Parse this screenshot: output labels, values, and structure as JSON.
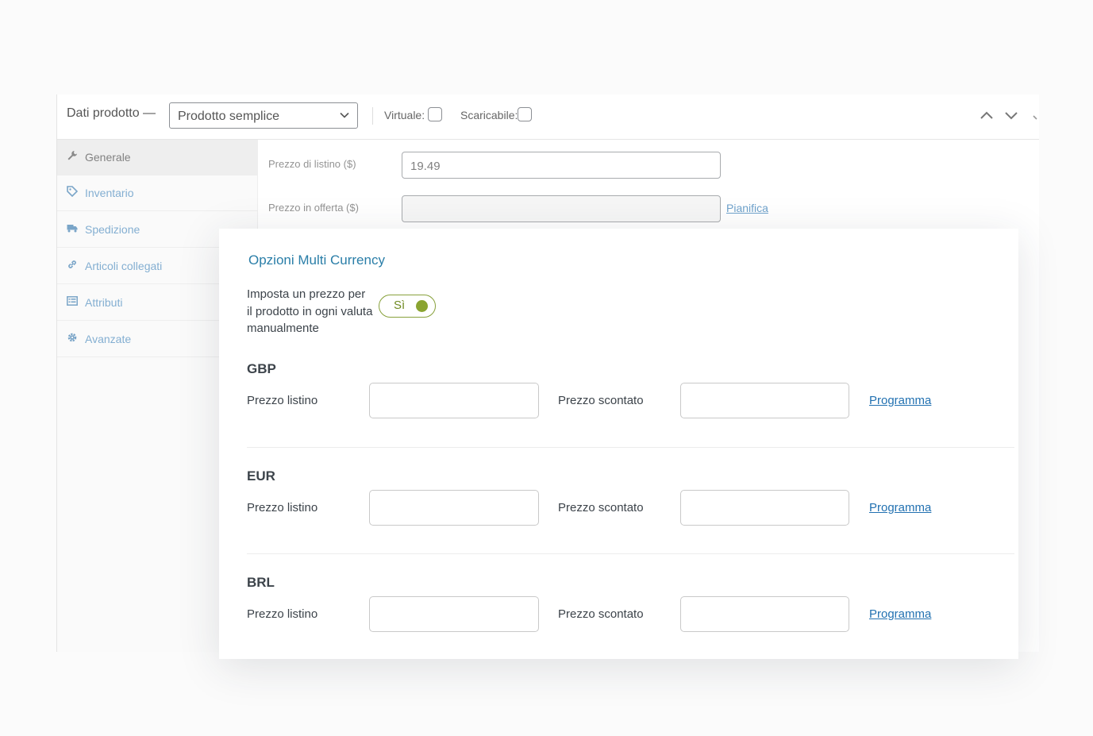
{
  "product_data": {
    "title": "Dati prodotto —",
    "product_type": "Prodotto semplice",
    "virtual_label": "Virtuale:",
    "downloadable_label": "Scaricabile:"
  },
  "tabs": [
    {
      "label": "Generale",
      "icon": "wrench-icon",
      "active": true
    },
    {
      "label": "Inventario",
      "icon": "tag-icon",
      "active": false
    },
    {
      "label": "Spedizione",
      "icon": "truck-icon",
      "active": false
    },
    {
      "label": "Articoli collegati",
      "icon": "link-icon",
      "active": false
    },
    {
      "label": "Attributi",
      "icon": "list-icon",
      "active": false
    },
    {
      "label": "Avanzate",
      "icon": "gear-icon",
      "active": false
    }
  ],
  "general": {
    "regular_price_label": "Prezzo di listino ($)",
    "regular_price_value": "19.49",
    "sale_price_label": "Prezzo in offerta ($)",
    "sale_price_value": "",
    "schedule_link": "Pianifica"
  },
  "multi_currency": {
    "title": "Opzioni Multi Currency",
    "manual_label": "Imposta un prezzo per il prodotto in ogni valuta manualmente",
    "toggle_label": "Sì",
    "toggle_on": true,
    "currencies": [
      {
        "code": "GBP",
        "regular_label": "Prezzo listino",
        "regular_value": "",
        "sale_label": "Prezzo scontato",
        "sale_value": "",
        "schedule_link": "Programma"
      },
      {
        "code": "EUR",
        "regular_label": "Prezzo listino",
        "regular_value": "",
        "sale_label": "Prezzo scontato",
        "sale_value": "",
        "schedule_link": "Programma"
      },
      {
        "code": "BRL",
        "regular_label": "Prezzo listino",
        "regular_value": "",
        "sale_label": "Prezzo scontato",
        "sale_value": "",
        "schedule_link": "Programma"
      }
    ]
  },
  "colors": {
    "accent": "#2271b1",
    "toggle_green": "#8aa431",
    "title_blue": "#2a7ea8"
  }
}
